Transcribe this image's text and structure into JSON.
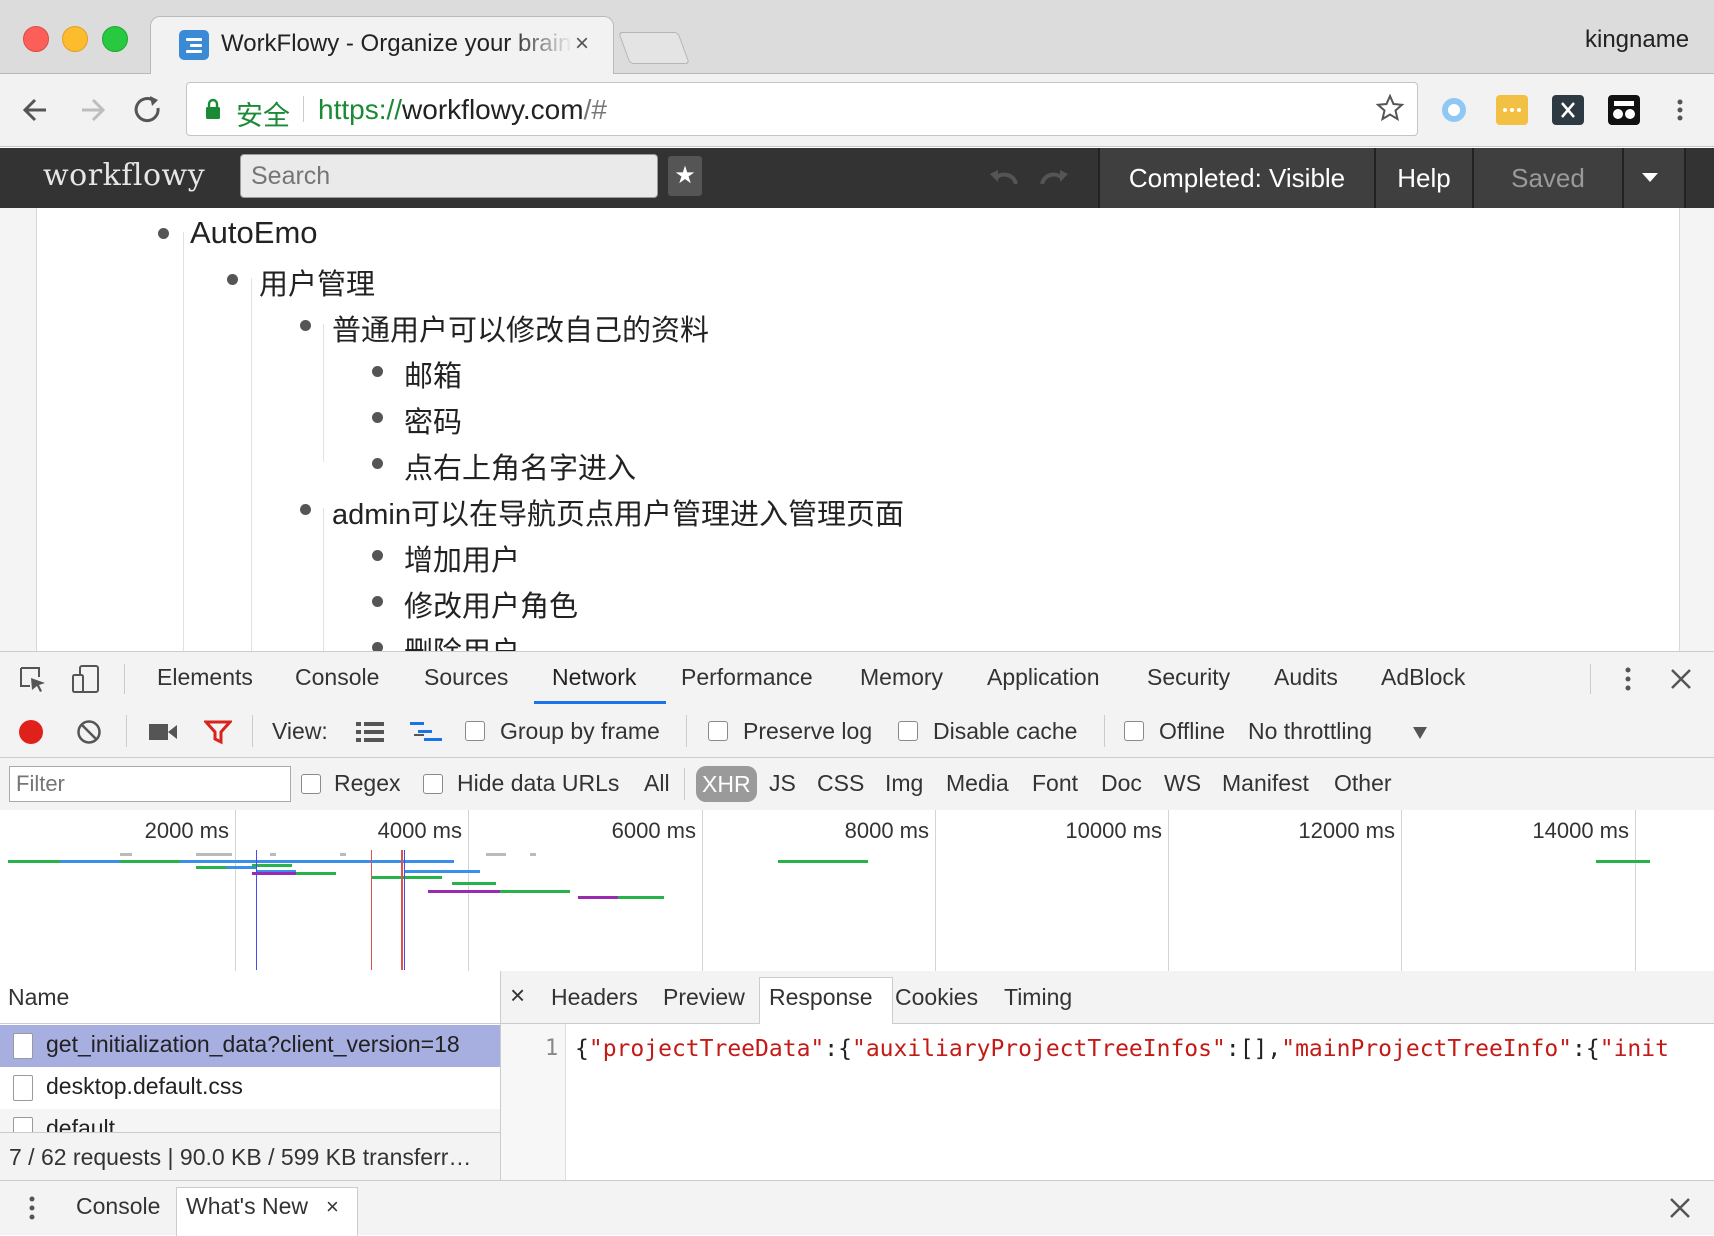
{
  "browser": {
    "tab_title": "WorkFlowy - Organize your brain",
    "tab_close": "×",
    "profile_name": "kingname",
    "security_label": "安全",
    "url_scheme": "https://",
    "url_host": "workflowy.com",
    "url_path": "/#"
  },
  "workflowy": {
    "logo": "workflowy",
    "search_placeholder": "Search",
    "star_label": "★",
    "completed_button": "Completed: Visible",
    "help_button": "Help",
    "saved_status": "Saved",
    "outline": [
      {
        "text": "AutoEmo",
        "level": 0
      },
      {
        "text": "用户管理",
        "level": 1
      },
      {
        "text": "普通用户可以修改自己的资料",
        "level": 2
      },
      {
        "text": "邮箱",
        "level": 3
      },
      {
        "text": "密码",
        "level": 3
      },
      {
        "text": "点右上角名字进入",
        "level": 3
      },
      {
        "text": "admin可以在导航页点用户管理进入管理页面",
        "level": 2
      },
      {
        "text": "增加用户",
        "level": 3
      },
      {
        "text": "修改用户角色",
        "level": 3
      },
      {
        "text": "删除用户",
        "level": 3
      }
    ]
  },
  "devtools": {
    "tabs": [
      "Elements",
      "Console",
      "Sources",
      "Network",
      "Performance",
      "Memory",
      "Application",
      "Security",
      "Audits",
      "AdBlock"
    ],
    "active_tab": "Network",
    "toolbar": {
      "view_label": "View:",
      "group_by_frame": "Group by frame",
      "preserve_log": "Preserve log",
      "disable_cache": "Disable cache",
      "offline": "Offline",
      "throttling": "No throttling"
    },
    "filter": {
      "placeholder": "Filter",
      "regex": "Regex",
      "hide_data_urls": "Hide data URLs",
      "types": [
        "All",
        "XHR",
        "JS",
        "CSS",
        "Img",
        "Media",
        "Font",
        "Doc",
        "WS",
        "Manifest",
        "Other"
      ],
      "active_type": "XHR"
    },
    "timeline_ticks": [
      "2000 ms",
      "4000 ms",
      "6000 ms",
      "8000 ms",
      "10000 ms",
      "12000 ms",
      "14000 ms"
    ],
    "requests": {
      "header": "Name",
      "rows": [
        "get_initialization_data?client_version=18",
        "desktop.default.css",
        "default"
      ],
      "summary": "7 / 62 requests | 90.0 KB / 599 KB transferr…"
    },
    "detail": {
      "close": "×",
      "tabs": [
        "Headers",
        "Preview",
        "Response",
        "Cookies",
        "Timing"
      ],
      "active_tab": "Response",
      "line_number": "1",
      "response_parts": [
        {
          "t": "{",
          "s": false
        },
        {
          "t": "\"projectTreeData\"",
          "s": true
        },
        {
          "t": ":{",
          "s": false
        },
        {
          "t": "\"auxiliaryProjectTreeInfos\"",
          "s": true
        },
        {
          "t": ":[],",
          "s": false
        },
        {
          "t": "\"mainProjectTreeInfo\"",
          "s": true
        },
        {
          "t": ":{",
          "s": false
        },
        {
          "t": "\"init",
          "s": true
        }
      ]
    },
    "drawer": {
      "tabs": [
        "Console",
        "What's New"
      ],
      "active_tab": "What's New",
      "close": "×"
    }
  },
  "colors": {
    "workflowy_bar": "#333333",
    "record_red": "#e0201b",
    "filter_red": "#d9231d",
    "selected_row": "#a7aee0",
    "active_tab_blue": "#1a73e8",
    "secure_green": "#1a8a36"
  },
  "icons": [
    "back-arrow-icon",
    "forward-arrow-icon",
    "reload-icon",
    "lock-icon",
    "bookmark-star-icon",
    "menu-kebab-icon",
    "inspect-icon",
    "device-toolbar-icon",
    "record-icon",
    "clear-icon",
    "camera-icon",
    "filter-icon",
    "list-view-icon",
    "waterfall-icon",
    "undo-icon",
    "redo-icon"
  ]
}
